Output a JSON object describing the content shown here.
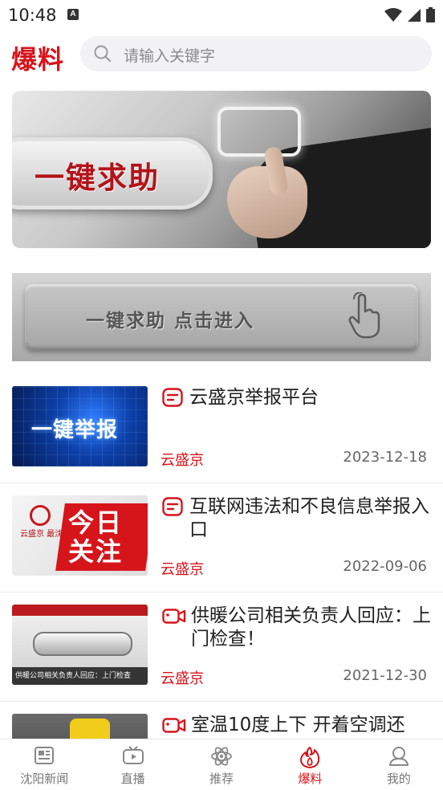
{
  "status_bar": {
    "time": "10:48",
    "badge": "A"
  },
  "header": {
    "brand": "爆料",
    "search_placeholder": "请输入关键字"
  },
  "banners": {
    "top_text": "一键求助",
    "second_text": "一键求助  点击进入"
  },
  "news": [
    {
      "title": "云盛京举报平台",
      "source": "云盛京",
      "date": "2023-12-18",
      "tag_icon": "article-icon",
      "thumb_text": "一键举报"
    },
    {
      "title": "互联网违法和不良信息举报入口",
      "source": "云盛京",
      "date": "2022-09-06",
      "tag_icon": "article-icon",
      "thumb_text": "今日关注",
      "thumb_side": "云盛京 最沈阳"
    },
    {
      "title": "供暖公司相关负责人回应：上门检查！",
      "source": "云盛京",
      "date": "2021-12-30",
      "tag_icon": "video-icon",
      "thumb_caption": "供暖公司相关负责人回应：上门检查"
    },
    {
      "title": "室温10度上下 开着空调还",
      "source": "",
      "date": "",
      "tag_icon": "video-icon"
    }
  ],
  "bottom_nav": [
    {
      "label": "沈阳新闻",
      "icon": "newspaper-icon",
      "active": false
    },
    {
      "label": "直播",
      "icon": "tv-icon",
      "active": false
    },
    {
      "label": "推荐",
      "icon": "atom-icon",
      "active": false
    },
    {
      "label": "爆料",
      "icon": "flame-icon",
      "active": true
    },
    {
      "label": "我的",
      "icon": "user-icon",
      "active": false
    }
  ],
  "colors": {
    "brand": "#d7141b",
    "muted": "#777777"
  }
}
